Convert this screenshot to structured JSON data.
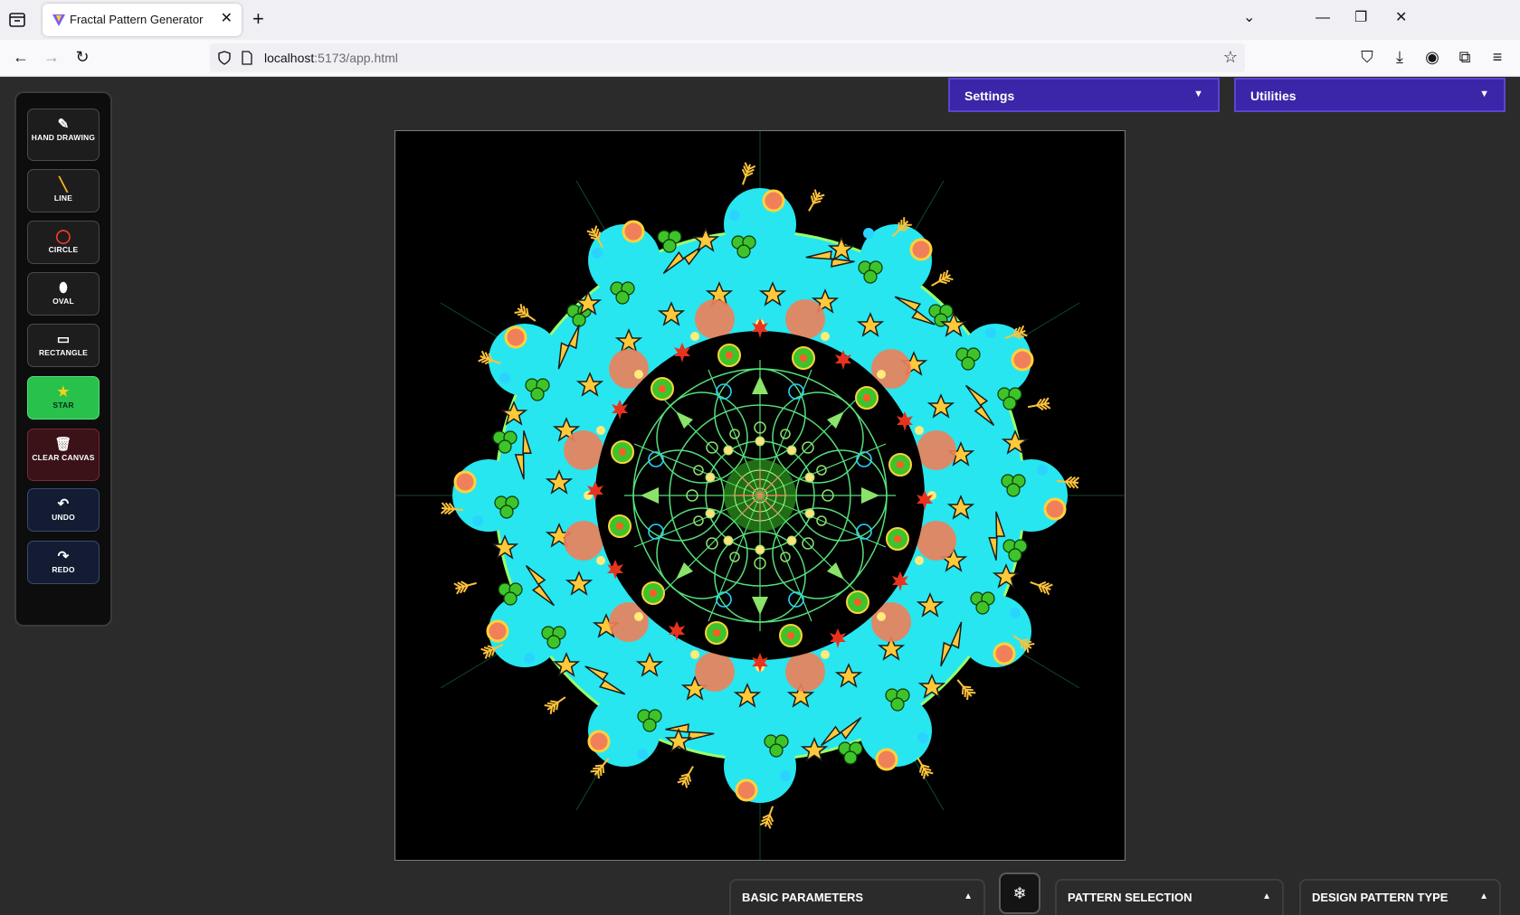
{
  "browser": {
    "tab_title": "Fractal Pattern Generator",
    "url_host": "localhost",
    "url_path": ":5173/app.html"
  },
  "toolbar": {
    "hand": "HAND DRAWING",
    "line": "LINE",
    "circle": "CIRCLE",
    "oval": "OVAL",
    "rectangle": "RECTANGLE",
    "star": "STAR",
    "clear": "CLEAR CANVAS",
    "undo": "UNDO",
    "redo": "REDO"
  },
  "menus": {
    "settings": "Settings",
    "utilities": "Utilities"
  },
  "panels": {
    "basic": "BASIC PARAMETERS",
    "pattern": "PATTERN SELECTION",
    "design": "DESIGN PATTERN TYPE"
  },
  "icons": {
    "active_tool": "star-icon",
    "center_button": "snowflake-icon"
  },
  "colors": {
    "active_tool": "#27c14c",
    "menu": "#3b25a8",
    "canvas_bg": "#000000",
    "mandala_cyan": "#27e6f0",
    "mandala_green": "#55e07a",
    "mandala_yellow": "#ffd23a",
    "mandala_coral": "#f0805a",
    "mandala_red": "#e8321e"
  }
}
